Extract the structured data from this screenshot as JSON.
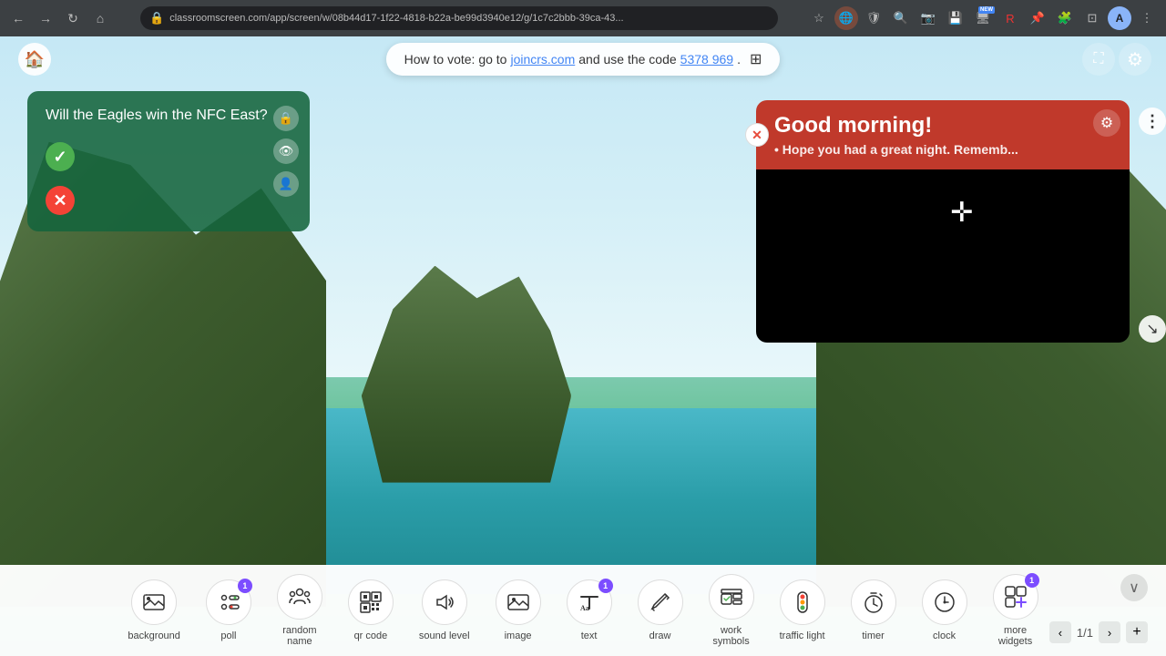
{
  "browser": {
    "url": "classroomscreen.com/app/screen/w/08b44d17-1f22-4818-b22a-be99d3940e12/g/1c7c2bbb-39ca-43...",
    "nav": {
      "back": "←",
      "forward": "→",
      "refresh": "↻",
      "home": "⌂"
    }
  },
  "topbar": {
    "home_icon": "⌂",
    "vote_text_prefix": "How to vote: go to",
    "vote_link": "joincrs.com",
    "vote_text_mid": "and use the code",
    "vote_code": "5378 969",
    "vote_text_suffix": ".",
    "grid_icon": "⊞",
    "settings_icon": "⚙",
    "fullscreen_icon": "⛶"
  },
  "poll": {
    "question": "Will the Eagles win the NFC East?",
    "yes_icon": "✓",
    "no_icon": "✕",
    "ctrl_icons": [
      "🔒",
      "👁",
      "👤"
    ]
  },
  "note": {
    "title": "Good morning!",
    "subtitle": "• Hope you had a great night. Rememb...",
    "close_icon": "✕",
    "settings_icon": "⚙",
    "more_icon": "⋮",
    "move_icon": "⤢",
    "resize_icon": "↘"
  },
  "toolbar": {
    "items": [
      {
        "id": "background",
        "label": "background",
        "icon": "background",
        "badge": null
      },
      {
        "id": "poll",
        "label": "poll",
        "icon": "poll",
        "badge": "1"
      },
      {
        "id": "random-name",
        "label": "random\nname",
        "icon": "random",
        "badge": null
      },
      {
        "id": "qr-code",
        "label": "qr code",
        "icon": "qr",
        "badge": null
      },
      {
        "id": "sound-level",
        "label": "sound level",
        "icon": "sound",
        "badge": null
      },
      {
        "id": "image",
        "label": "image",
        "icon": "image",
        "badge": null
      },
      {
        "id": "text",
        "label": "text",
        "icon": "text",
        "badge": "1"
      },
      {
        "id": "draw",
        "label": "draw",
        "icon": "draw",
        "badge": null
      },
      {
        "id": "work-symbols",
        "label": "work\nsymbols",
        "icon": "work",
        "badge": null
      },
      {
        "id": "traffic-light",
        "label": "traffic light",
        "icon": "traffic",
        "badge": null
      },
      {
        "id": "timer",
        "label": "timer",
        "icon": "timer",
        "badge": null
      },
      {
        "id": "clock",
        "label": "clock",
        "icon": "clock",
        "badge": null
      },
      {
        "id": "more-widgets",
        "label": "more\nwidgets",
        "icon": "more",
        "badge": "1"
      }
    ],
    "page_current": "1",
    "page_total": "1",
    "collapse_icon": "∨",
    "prev_icon": "‹",
    "next_icon": "›",
    "add_icon": "+"
  }
}
